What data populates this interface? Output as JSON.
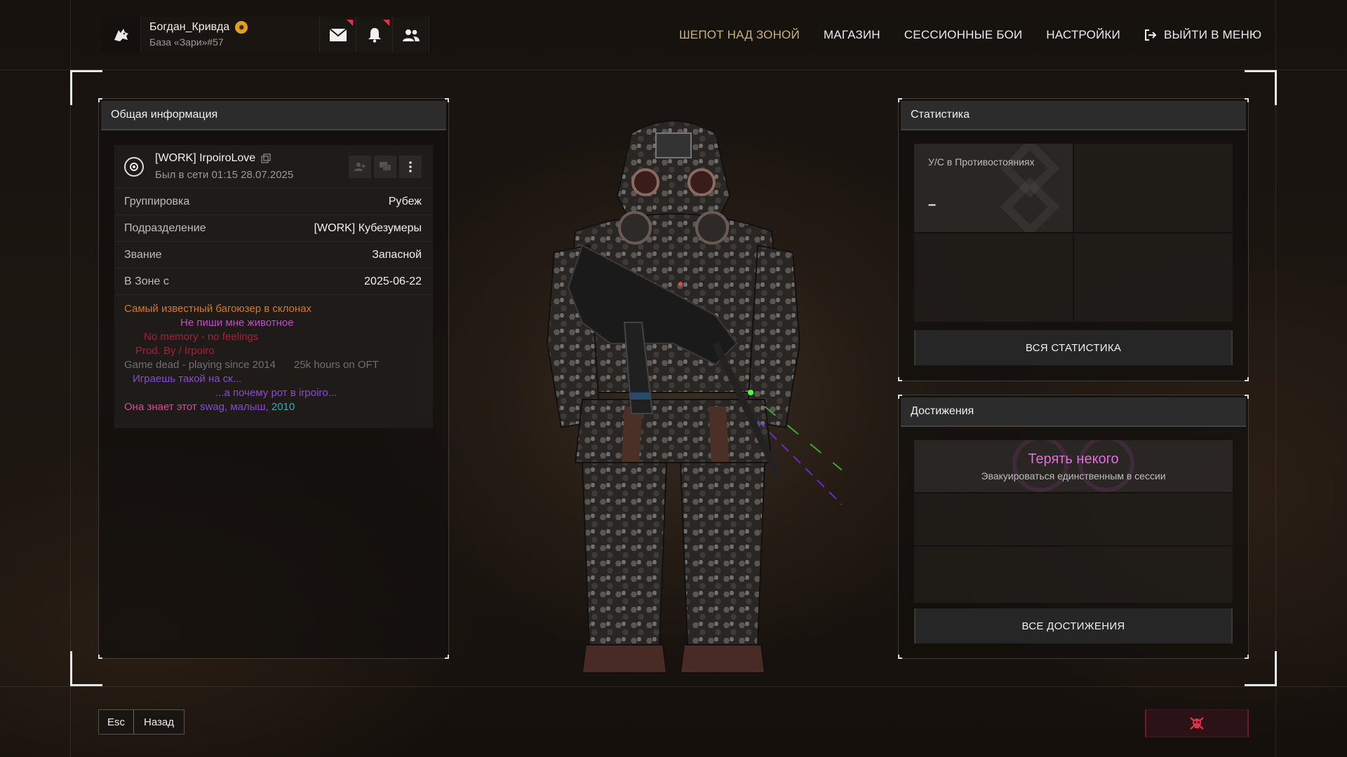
{
  "player": {
    "name": "Богдан_Кривда",
    "base": "База «Зари»#57"
  },
  "nav": {
    "items": [
      "ШЕПОТ НАД ЗОНОЙ",
      "МАГАЗИН",
      "СЕССИОННЫЕ БОИ",
      "НАСТРОЙКИ"
    ],
    "exit": "ВЫЙТИ В МЕНЮ"
  },
  "general": {
    "title": "Общая информация",
    "nick": "[WORK] IrpoiroLove",
    "seen": "Был в сети 01:15 28.07.2025",
    "rows": [
      {
        "k": "Группировка",
        "v": "Рубеж"
      },
      {
        "k": "Подразделение",
        "v": "[WORK] Кубезумеры"
      },
      {
        "k": "Звание",
        "v": "Запасной"
      },
      {
        "k": "В Зоне с",
        "v": "2025-06-22"
      }
    ],
    "bio": {
      "l1": "Самый известный багоюзер в склонах",
      "l2": "Не пиши мне животное",
      "l3": "No memory - no feelings",
      "l4": "Prod. By / Irpoiro",
      "l5a": "Game dead - playing since 2014",
      "l5b": "25k hours on OFT",
      "l6": "Играешь такой на ск...",
      "l7": "...а почему рот в irpoiro...",
      "l8a": "Она знает этот ",
      "l8b": "swag, малыш, ",
      "l8c": "2010"
    }
  },
  "stats": {
    "title": "Статистика",
    "kd_label": "У/С в Противостояниях",
    "kd_value": "–",
    "all_button": "ВСЯ СТАТИСТИКА"
  },
  "achievements": {
    "title": "Достижения",
    "item_title": "Терять некого",
    "item_desc": "Эвакуироваться единственным в сессии",
    "all_button": "ВСЕ ДОСТИЖЕНИЯ"
  },
  "bottom": {
    "esc_key": "Esc",
    "back_label": "Назад"
  },
  "colors": {
    "nav_active": "#c9b27a",
    "bio_orange": "#d07a28",
    "bio_magenta": "#c845d0",
    "bio_red": "#a8203a",
    "bio_gray": "#6f6f6f",
    "bio_purple": "#8a4ad0",
    "bio_pink": "#d84a9a",
    "bio_teal": "#3aa8b8",
    "achievement_title": "#e070d8",
    "danger_button": "#6b1d2a"
  },
  "icons": [
    "wolf-logo-icon",
    "medal-icon",
    "mail-icon",
    "bell-icon",
    "friends-icon",
    "exit-icon",
    "copy-icon",
    "add-friend-icon",
    "chat-icon",
    "more-icon",
    "faction-emblem-icon",
    "skull-crossbones-icon"
  ]
}
